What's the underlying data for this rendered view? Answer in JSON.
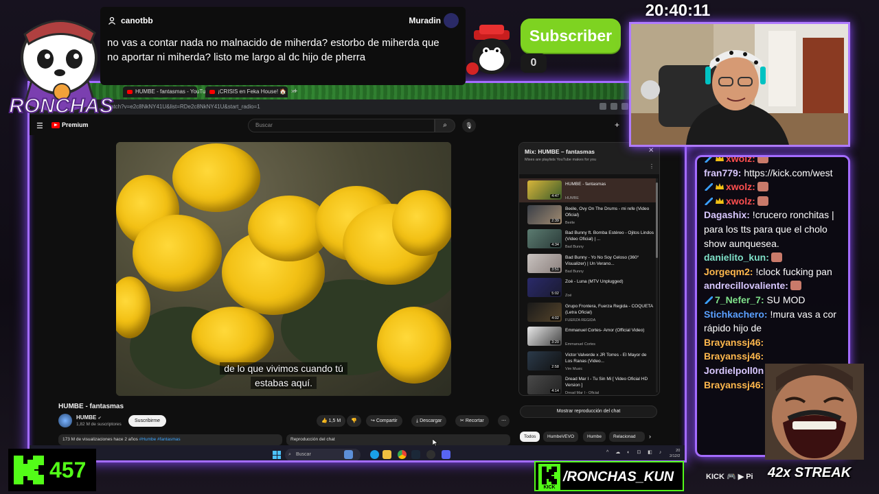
{
  "browser": {
    "tabs": [
      {
        "label": "HUMBE - fantasmas - YouTube",
        "active": true
      },
      {
        "label": "¡CRISIS en Feka House! 🏠",
        "active": false
      }
    ],
    "new_tab": "+",
    "url": "atch?v=e2c8NkNY41U&list=RDe2c8NkNY41U&start_radio=1"
  },
  "youtube": {
    "menu_icon": "☰",
    "logo_text": "Premium",
    "search_placeholder": "Buscar",
    "create_icon": "+",
    "video_subtitle_line1": "de lo que vivimos cuando tú",
    "video_subtitle_line2": "estabas aquí.",
    "title": "HUMBE - fantasmas",
    "channel": "HUMBE",
    "verified": "✔",
    "subscribers": "1,82 M de suscriptores",
    "subscribe_label": "Suscribirme",
    "likes": "1,5 M",
    "share_label": "Compartir",
    "download_label": "Descargar",
    "clip_label": "Recortar",
    "more_label": "⋯",
    "description_stats": "173 M de visualizaciones  hace 2 años ",
    "description_tags": "#Humbe #fantasmas",
    "chat_replay_bar": "Reproducción del chat"
  },
  "mix": {
    "title": "Mix: HUMBE – fantasmas",
    "subtitle": "Mixes are playlists YouTube makes for you",
    "close": "✕",
    "more": "⋮",
    "items": [
      {
        "title": "HUMBE - fantasmas",
        "artist": "HUMBE",
        "duration": "4:47",
        "active": true,
        "c1": "#d8b53a",
        "c2": "#3b5b2a"
      },
      {
        "title": "Beéle, Ovy On The Drums - mi refe (Video Oficial)",
        "artist": "Beéle",
        "duration": "2:39",
        "active": false,
        "c1": "#3a3f48",
        "c2": "#a08a70"
      },
      {
        "title": "Bad Bunny ft. Bomba Estéreo - Ojitos Lindos (Video Oficial) | ...",
        "artist": "Bad Bunny",
        "duration": "4:34",
        "active": false,
        "c1": "#5b7b70",
        "c2": "#2a3a38"
      },
      {
        "title": "Bad Bunny - Yo No Soy Celoso (360° Visualizer) | Un Verano...",
        "artist": "Bad Bunny",
        "duration": "3:51",
        "active": false,
        "c1": "#c9c3c0",
        "c2": "#8a7f7c"
      },
      {
        "title": "Zoé - Luna (MTV Unplugged)",
        "artist": "Zoé",
        "duration": "5:02",
        "active": false,
        "c1": "#2a2a6a",
        "c2": "#1a1a30"
      },
      {
        "title": "Grupo Frontera, Fuerza Regida - COQUETA (Letra Oficial)",
        "artist": "FUERZA REGIDA",
        "duration": "4:02",
        "active": false,
        "c1": "#1a1a1a",
        "c2": "#55442a"
      },
      {
        "title": "Emmanuel Cortes- Amor (Official Video)",
        "artist": "Emmanuel Cortes",
        "duration": "3:20",
        "active": false,
        "c1": "#e8e8e8",
        "c2": "#444444"
      },
      {
        "title": "Victor Valverde x JR Torres - El Mayor de Los Ranas (Video...",
        "artist": "Vim Music",
        "duration": "2:58",
        "active": false,
        "c1": "#2b3a4a",
        "c2": "#111111"
      },
      {
        "title": "Dread Mar I - Tu Sin Mi [ Video Oficial HD Version ]",
        "artist": "Dread Mar I - Oficial",
        "duration": "4:14",
        "active": false,
        "c1": "#4a4a4a",
        "c2": "#222222"
      }
    ],
    "show_chat_replay": "Mostrar reproducción del chat",
    "chips": [
      {
        "label": "Todos",
        "selected": true
      },
      {
        "label": "HumbeVEVO",
        "selected": false
      },
      {
        "label": "Humbe",
        "selected": false
      },
      {
        "label": "Relacionad",
        "selected": false
      }
    ],
    "chips_next": "›"
  },
  "taskbar": {
    "search_placeholder": "Buscar",
    "tray": "^ ☁ ◐ ⊡ ◧ ♪",
    "time": "20",
    "date": "2/12/2"
  },
  "overlay": {
    "logo_text": "RONCHAS",
    "message_user": "canotbb",
    "message_target": "Muradin",
    "message_text": "no vas a contar nada no malnacido de miherda? estorbo de miherda que no aportar ni miherda? listo me largo al dc hijo de pherra",
    "subscriber_label": "Subscriber",
    "subscriber_count": "0",
    "stream_timer": "20:40:11",
    "kick_count": "457",
    "kick_handle": "/RONCHAS_KUN",
    "kick_handle_logo": "KICK",
    "socials_text": "KICK 🎮 ▶ Pi",
    "streak_text": "42x STREAK"
  },
  "chat": {
    "messages": [
      {
        "user": "xwolz:",
        "text": "",
        "color": "#ff4f4f",
        "badges": true,
        "emote": true
      },
      {
        "user": "fran779:",
        "text": " https://kick.com/west",
        "color": "#d9c8ff",
        "badges": false,
        "emote": false
      },
      {
        "user": "xwolz:",
        "text": "",
        "color": "#ff4f4f",
        "badges": true,
        "emote": true
      },
      {
        "user": "xwolz:",
        "text": "",
        "color": "#ff4f4f",
        "badges": true,
        "emote": true
      },
      {
        "user": "Dagashix:",
        "text": " !crucero ronchitas |",
        "color": "#d9c8ff",
        "badges": false,
        "emote": false
      },
      {
        "user": "",
        "text": "para los tts para que el cholo",
        "color": "#ffffff",
        "badges": false,
        "emote": false
      },
      {
        "user": "",
        "text": "show aunquesea.",
        "color": "#ffffff",
        "badges": false,
        "emote": false
      },
      {
        "user": "danielito_kun:",
        "text": "",
        "color": "#7fe0c8",
        "badges": false,
        "emote": true
      },
      {
        "user": "Jorgeqm2:",
        "text": " !clock fucking pan",
        "color": "#ffb84d",
        "badges": false,
        "emote": false
      },
      {
        "user": "andrecillovaliente:",
        "text": "",
        "color": "#d9c8ff",
        "badges": false,
        "emote": true
      },
      {
        "user": "7_Nefer_7:",
        "text": " SU MOD",
        "color": "#7fe08a",
        "badges": true,
        "emote": false
      },
      {
        "user": "Stichkachero:",
        "text": " !mura vas a cor",
        "color": "#5aa0ff",
        "badges": false,
        "emote": false
      },
      {
        "user": "",
        "text": "rápido hijo de",
        "color": "#ffffff",
        "badges": false,
        "emote": false
      },
      {
        "user": "Brayanssj46:",
        "text": "",
        "color": "#ffb84d",
        "badges": false,
        "emote": false
      },
      {
        "user": "Brayanssj46:",
        "text": "",
        "color": "#ffb84d",
        "badges": false,
        "emote": false
      },
      {
        "user": "Jordielpoll0n",
        "text": "",
        "color": "#d9c8ff",
        "badges": false,
        "emote": false
      },
      {
        "user": "Brayanssj46:",
        "text": "",
        "color": "#ffb84d",
        "badges": false,
        "emote": false
      }
    ]
  },
  "colors": {
    "accent_purple": "#a46cff",
    "kick_green": "#53fc18",
    "subscriber_green": "#7ed321",
    "youtube_red": "#ff0000"
  }
}
